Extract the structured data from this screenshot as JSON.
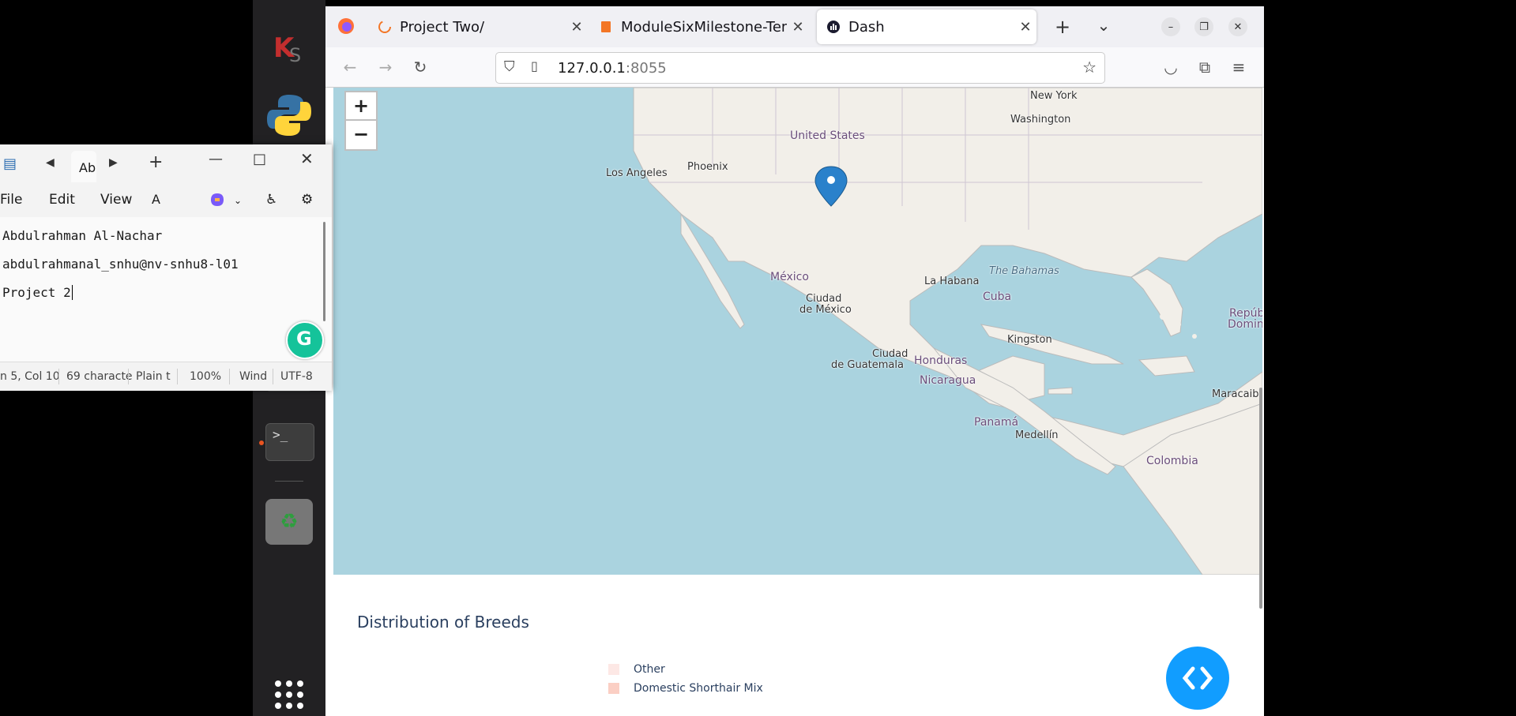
{
  "browser": {
    "tabs": [
      {
        "title": "Project Two/"
      },
      {
        "title": "ModuleSixMilestone-Tem"
      },
      {
        "title": "Dash"
      }
    ],
    "url_host": "127.0.0.1",
    "url_port": ":8055"
  },
  "map": {
    "zoom_in": "+",
    "zoom_out": "−",
    "labels": {
      "new_york": "New York",
      "washington": "Washington",
      "united_states": "United States",
      "phoenix": "Phoenix",
      "los_angeles": "Los Angeles",
      "mexico": "México",
      "ciudad_de": "Ciudad",
      "de_mexico": "de México",
      "la_habana": "La Habana",
      "bahamas": "The Bahamas",
      "cuba": "Cuba",
      "republica": "Repúbl",
      "dominicana": "Dominic",
      "kingston": "Kingston",
      "ciudad_guatemala": "Ciudad",
      "de_guatemala": "de Guatemala",
      "honduras": "Honduras",
      "nicaragua": "Nicaragua",
      "maracaibo": "Maracaibo",
      "panama": "Panamá",
      "medellin": "Medellín",
      "colombia": "Colombia"
    }
  },
  "chart": {
    "title": "Distribution of Breeds",
    "legend": [
      {
        "label": "Other",
        "color": "#fde8e5"
      },
      {
        "label": "Domestic Shorthair Mix",
        "color": "#fbcfc4"
      }
    ]
  },
  "notepad": {
    "tab_label": "Ab",
    "menu": {
      "file": "File",
      "edit": "Edit",
      "view": "View"
    },
    "lines": {
      "line1": "Abdulrahman Al-Nachar",
      "line2": "abdulrahmanal_snhu@nv-snhu8-l01",
      "line3": "Project 2"
    },
    "status": {
      "position": "n 5, Col 10",
      "chars": "69 characte",
      "format": "Plain t",
      "zoom": "100%",
      "eol": "Wind",
      "encoding": "UTF-8"
    }
  }
}
